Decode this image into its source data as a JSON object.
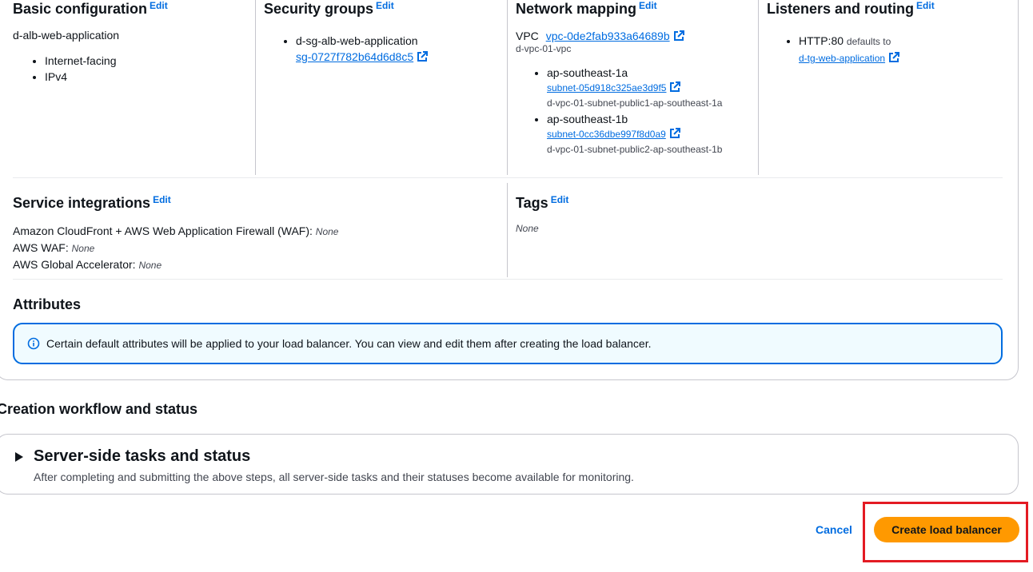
{
  "basic": {
    "title": "Basic configuration",
    "edit": "Edit",
    "name": "d-alb-web-application",
    "items": [
      "Internet-facing",
      "IPv4"
    ]
  },
  "security": {
    "title": "Security groups",
    "edit": "Edit",
    "group_name": "d-sg-alb-web-application",
    "group_id": "sg-0727f782b64d6d8c5"
  },
  "network": {
    "title": "Network mapping",
    "edit": "Edit",
    "vpc_label": "VPC",
    "vpc_id": "vpc-0de2fab933a64689b",
    "vpc_name": "d-vpc-01-vpc",
    "zones": [
      {
        "az": "ap-southeast-1a",
        "subnet_id": "subnet-05d918c325ae3d9f5",
        "subnet_name": "d-vpc-01-subnet-public1-ap-southeast-1a"
      },
      {
        "az": "ap-southeast-1b",
        "subnet_id": "subnet-0cc36dbe997f8d0a9",
        "subnet_name": "d-vpc-01-subnet-public2-ap-southeast-1b"
      }
    ]
  },
  "listeners": {
    "title": "Listeners and routing",
    "edit": "Edit",
    "listener": "HTTP:80",
    "defaults_to": "defaults to",
    "target_group": "d-tg-web-application"
  },
  "service": {
    "title": "Service integrations",
    "edit": "Edit",
    "rows": [
      {
        "label": "Amazon CloudFront + AWS Web Application Firewall (WAF):",
        "value": "None"
      },
      {
        "label": "AWS WAF:",
        "value": "None"
      },
      {
        "label": "AWS Global Accelerator:",
        "value": "None"
      }
    ]
  },
  "tags": {
    "title": "Tags",
    "edit": "Edit",
    "value": "None"
  },
  "attributes": {
    "title": "Attributes",
    "alert": "Certain default attributes will be applied to your load balancer. You can view and edit them after creating the load balancer."
  },
  "workflow": {
    "title": "Creation workflow and status",
    "tasks_title": "Server-side tasks and status",
    "tasks_desc": "After completing and submitting the above steps, all server-side tasks and their statuses become available for monitoring."
  },
  "actions": {
    "cancel": "Cancel",
    "create": "Create load balancer"
  },
  "colors": {
    "link": "#006ce0",
    "primary_button": "#ff9900",
    "highlight": "#e31b23",
    "alert_border": "#006ce0"
  }
}
